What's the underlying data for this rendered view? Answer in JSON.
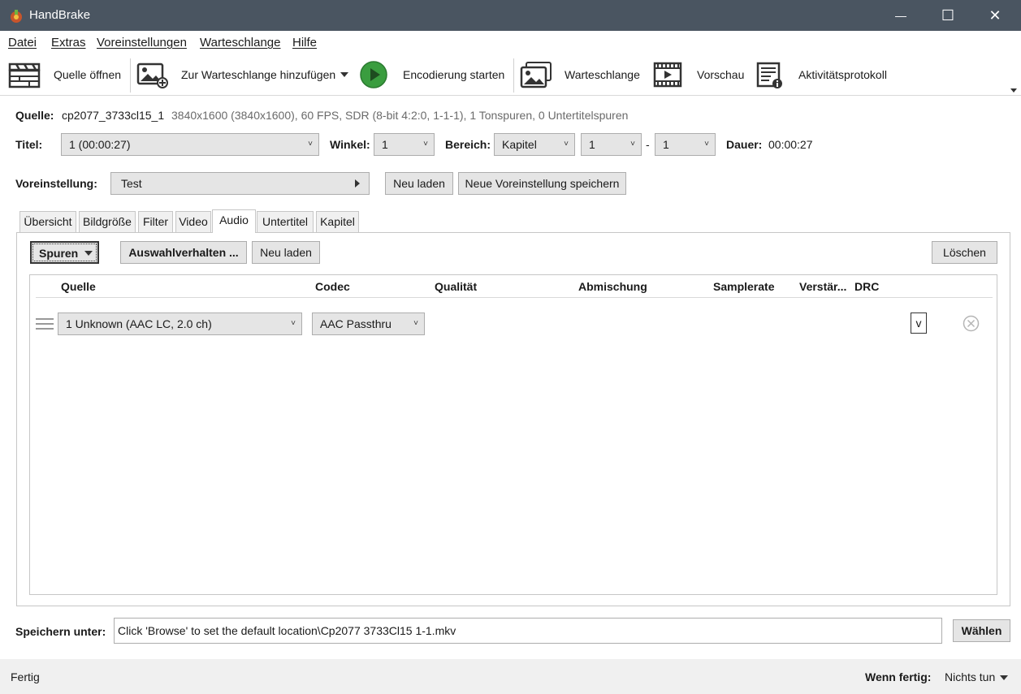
{
  "window": {
    "title": "HandBrake",
    "minimize": "—",
    "maximize": "☐",
    "close": "✕"
  },
  "menu": [
    "Datei",
    "Extras",
    "Voreinstellungen",
    "Warteschlange",
    "Hilfe"
  ],
  "toolbar": {
    "open_source": "Quelle öffnen",
    "add_queue": "Zur Warteschlange hinzufügen",
    "start_encode": "Encodierung starten",
    "queue": "Warteschlange",
    "preview": "Vorschau",
    "activity_log": "Aktivitätsprotokoll"
  },
  "source": {
    "label": "Quelle:",
    "name": "cp2077_3733cl15_1",
    "info": "3840x1600 (3840x1600), 60 FPS, SDR (8-bit 4:2:0, 1-1-1), 1 Tonspuren, 0 Untertitelspuren"
  },
  "title_row": {
    "title_label": "Titel:",
    "title_value": "1  (00:00:27)",
    "angle_label": "Winkel:",
    "angle_value": "1",
    "range_label": "Bereich:",
    "range_type": "Kapitel",
    "range_start": "1",
    "range_sep": "-",
    "range_end": "1",
    "duration_label": "Dauer:",
    "duration_value": "00:00:27"
  },
  "preset": {
    "label": "Voreinstellung:",
    "value": "Test",
    "reload": "Neu laden",
    "save_new": "Neue Voreinstellung speichern"
  },
  "tabs": [
    "Übersicht",
    "Bildgröße",
    "Filter",
    "Video",
    "Audio",
    "Untertitel",
    "Kapitel"
  ],
  "active_tab": "Audio",
  "audio": {
    "tracks_btn": "Spuren",
    "selection_behavior": "Auswahlverhalten ...",
    "reload": "Neu laden",
    "clear": "Löschen",
    "columns": [
      "Quelle",
      "Codec",
      "Qualität",
      "Abmischung",
      "Samplerate",
      "Verstär...",
      "DRC"
    ],
    "track": {
      "source": "1 Unknown (AAC LC, 2.0 ch)",
      "codec": "AAC Passthru",
      "extra": "v"
    }
  },
  "output": {
    "label": "Speichern unter:",
    "path": "Click 'Browse' to set the default location\\Cp2077 3733Cl15 1-1.mkv",
    "browse": "Wählen"
  },
  "status": {
    "text": "Fertig",
    "when_done_label": "Wenn fertig:",
    "when_done_value": "Nichts tun"
  }
}
